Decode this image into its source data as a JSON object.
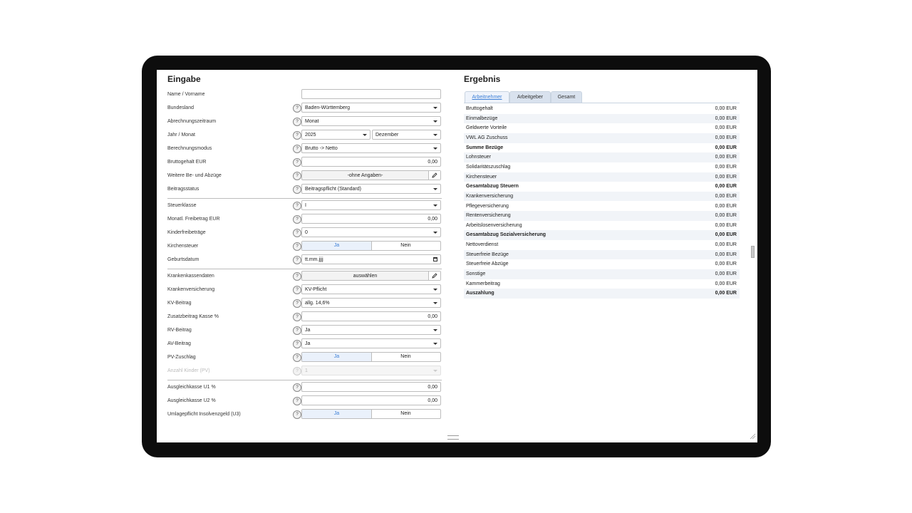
{
  "left": {
    "title": "Eingabe",
    "fields": [
      {
        "label": "Name / Vorname",
        "type": "input",
        "value": "",
        "help": false
      },
      {
        "label": "Bundesland",
        "type": "select",
        "value": "Baden-Württemberg",
        "help": true
      },
      {
        "label": "Abrechnungszeitraum",
        "type": "select",
        "value": "Monat",
        "help": true
      },
      {
        "label": "Jahr / Monat",
        "type": "select2",
        "value": "2025",
        "value2": "Dezember",
        "help": true
      },
      {
        "label": "Berechnungsmodus",
        "type": "select",
        "value": "Brutto -> Netto",
        "help": true
      },
      {
        "label": "Bruttogehalt EUR",
        "type": "input",
        "value": "0,00",
        "help": true
      },
      {
        "label": "Weitere Be- und Abzüge",
        "type": "button",
        "value": "-ohne Angaben-",
        "help": true
      },
      {
        "label": "Beitragsstatus",
        "type": "select",
        "value": "Beitragspflicht (Standard)",
        "help": true
      },
      {
        "label": "Steuerklasse",
        "type": "select",
        "value": "I",
        "help": true
      },
      {
        "label": "Monatl. Freibetrag EUR",
        "type": "input",
        "value": "0,00",
        "help": true
      },
      {
        "label": "Kinderfreibeträge",
        "type": "select",
        "value": "0",
        "help": true
      },
      {
        "label": "Kirchensteuer",
        "type": "toggle",
        "yes": "Ja",
        "no": "Nein",
        "help": true
      },
      {
        "label": "Geburtsdatum",
        "type": "date",
        "value": "tt.mm.jjjj",
        "help": true
      },
      {
        "label": "Krankenkassendaten",
        "type": "button",
        "value": "auswählen",
        "help": true
      },
      {
        "label": "Krankenversicherung",
        "type": "select",
        "value": "KV-Pflicht",
        "help": true
      },
      {
        "label": "KV-Beitrag",
        "type": "select",
        "value": "allg. 14,6%",
        "help": true
      },
      {
        "label": "Zusatzbeitrag Kasse %",
        "type": "input",
        "value": "0,00",
        "help": true
      },
      {
        "label": "RV-Beitrag",
        "type": "select",
        "value": "Ja",
        "help": true
      },
      {
        "label": "AV-Beitrag",
        "type": "select",
        "value": "Ja",
        "help": true
      },
      {
        "label": "PV-Zuschlag",
        "type": "toggle",
        "yes": "Ja",
        "no": "Nein",
        "help": true
      },
      {
        "label": "Anzahl Kinder (PV)",
        "type": "select",
        "value": "1",
        "help": true,
        "disabled": true
      },
      {
        "label": "Ausgleichkasse U1 %",
        "type": "input",
        "value": "0,00",
        "help": true
      },
      {
        "label": "Ausgleichkasse U2 %",
        "type": "input",
        "value": "0,00",
        "help": true
      },
      {
        "label": "Umlagepflicht Insolvenzgeld (U3)",
        "type": "toggle",
        "yes": "Ja",
        "no": "Nein",
        "help": true
      }
    ]
  },
  "right": {
    "title": "Ergebnis",
    "tabs": [
      "Arbeitnehmer",
      "Arbeitgeber",
      "Gesamt"
    ],
    "active_tab": 0,
    "rows": [
      {
        "label": "Bruttogehalt",
        "value": "0,00 EUR",
        "bold": false
      },
      {
        "label": "Einmalbezüge",
        "value": "0,00 EUR",
        "bold": false
      },
      {
        "label": "Geldwerte Vorteile",
        "value": "0,00 EUR",
        "bold": false
      },
      {
        "label": "VWL AG Zuschuss",
        "value": "0,00 EUR",
        "bold": false
      },
      {
        "label": "Summe Bezüge",
        "value": "0,00 EUR",
        "bold": true
      },
      {
        "label": "Lohnsteuer",
        "value": "0,00 EUR",
        "bold": false
      },
      {
        "label": "Solidaritätszuschlag",
        "value": "0,00 EUR",
        "bold": false
      },
      {
        "label": "Kirchensteuer",
        "value": "0,00 EUR",
        "bold": false
      },
      {
        "label": "Gesamtabzug Steuern",
        "value": "0,00 EUR",
        "bold": true
      },
      {
        "label": "Krankenversicherung",
        "value": "0,00 EUR",
        "bold": false
      },
      {
        "label": "Pflegeversicherung",
        "value": "0,00 EUR",
        "bold": false
      },
      {
        "label": "Rentenversicherung",
        "value": "0,00 EUR",
        "bold": false
      },
      {
        "label": "Arbeitslosenversicherung",
        "value": "0,00 EUR",
        "bold": false
      },
      {
        "label": "Gesamtabzug Sozialversicherung",
        "value": "0,00 EUR",
        "bold": true
      },
      {
        "label": "Nettoverdienst",
        "value": "0,00 EUR",
        "bold": false
      },
      {
        "label": "Steuerfreie Bezüge",
        "value": "0,00 EUR",
        "bold": false
      },
      {
        "label": "Steuerfreie Abzüge",
        "value": "0,00 EUR",
        "bold": false
      },
      {
        "label": "Sonstige",
        "value": "0,00 EUR",
        "bold": false
      },
      {
        "label": "Kammerbeitrag",
        "value": "0,00 EUR",
        "bold": false
      },
      {
        "label": "Auszahlung",
        "value": "0,00 EUR",
        "bold": true
      }
    ]
  },
  "colors": {
    "accent": "#3b7ed6",
    "tab_bg": "#d9e2ee",
    "row_alt": "#f1f4f8"
  }
}
